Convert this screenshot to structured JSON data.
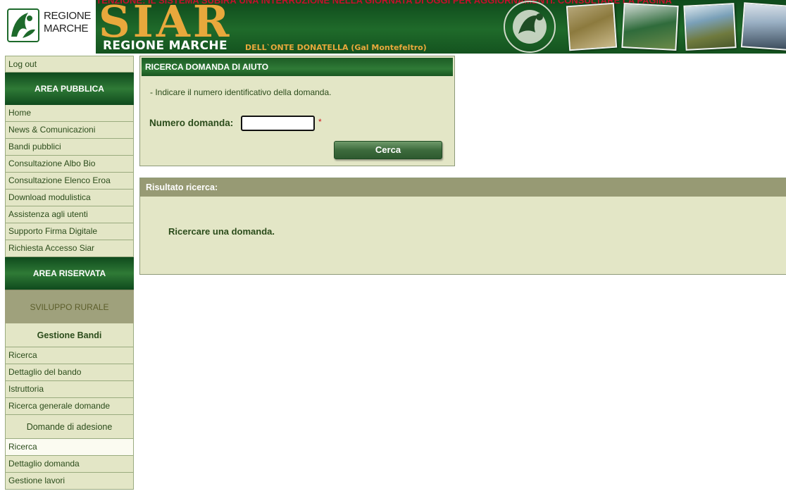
{
  "header": {
    "ticker": "ATTENZIONE: IL SISTEMA SUBIRÀ UNA INTERRUZIONE NELLA GIORNATA DI OGGI PER AGGIORNAMENTI. CONSULTARE LA PAGINA",
    "logo_line1": "REGIONE",
    "logo_line2": "MARCHE",
    "app_name": "SIAR",
    "region_name": "REGIONE MARCHE",
    "user": "DELL`ONTE DONATELLA (Gal Montefeltro)"
  },
  "sidebar": {
    "logout": "Log out",
    "area_pubblica": "AREA PUBBLICA",
    "public_links": [
      "Home",
      "News & Comunicazioni",
      "Bandi pubblici",
      "Consultazione Albo Bio",
      "Consultazione Elenco Eroa",
      "Download modulistica",
      "Assistenza agli utenti",
      "Supporto Firma Digitale",
      "Richiesta Accesso Siar"
    ],
    "area_riservata": "AREA RISERVATA",
    "sviluppo_rurale": "SVILUPPO RURALE",
    "gestione_bandi": "Gestione Bandi",
    "bandi_links": [
      "Ricerca",
      "Dettaglio del bando",
      "Istruttoria",
      "Ricerca generale domande"
    ],
    "domande_adesione": "Domande di adesione",
    "domande_links": [
      "Ricerca",
      "Dettaglio domanda",
      "Gestione lavori"
    ]
  },
  "search": {
    "title": "RICERCA DOMANDA DI AIUTO",
    "hint": "- Indicare il numero identificativo della domanda.",
    "field_label": "Numero domanda:",
    "field_value": "",
    "required_mark": "*",
    "button": "Cerca"
  },
  "results": {
    "title": "Risultato ricerca:",
    "message": "Ricercare una domanda."
  }
}
